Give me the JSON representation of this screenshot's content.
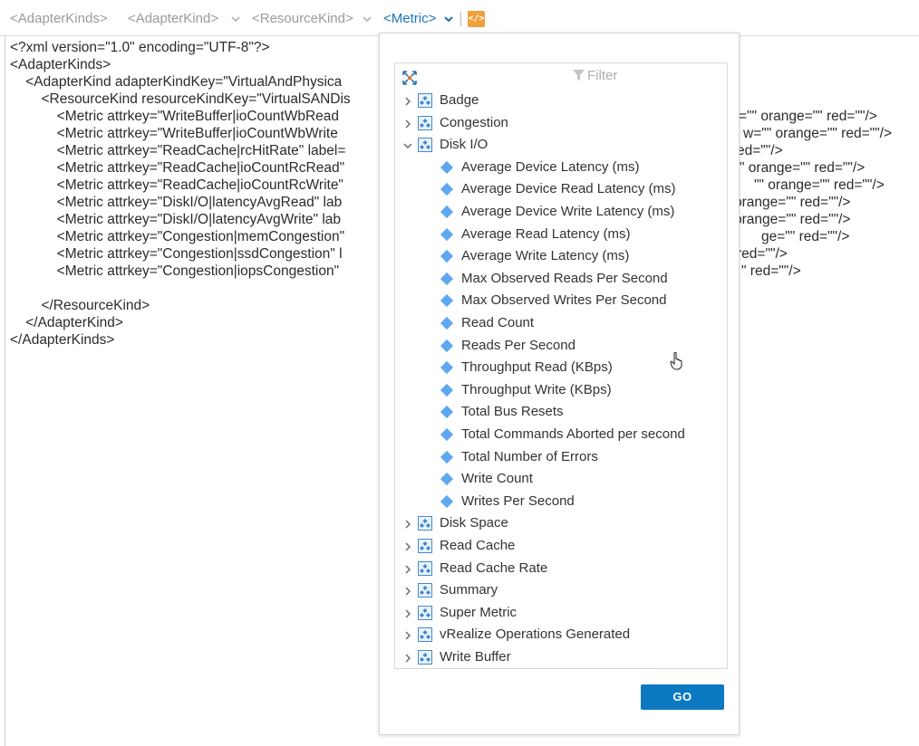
{
  "breadcrumbs": [
    {
      "label": "<AdapterKinds>"
    },
    {
      "label": "<AdapterKind>"
    },
    {
      "label": "<ResourceKind>"
    },
    {
      "label": "<Metric>"
    }
  ],
  "xml_toggle_label": "</>",
  "xml_lines": [
    "<?xml version=\"1.0\" encoding=\"UTF-8\"?>",
    "<AdapterKinds>",
    "    <AdapterKind adapterKindKey=\"VirtualAndPhysica",
    "        <ResourceKind resourceKindKey=\"VirtualSANDis",
    "            <Metric attrkey=\"WriteBuffer|ioCountWbRead",
    "            <Metric attrkey=\"WriteBuffer|ioCountWbWrite",
    "            <Metric attrkey=\"ReadCache|rcHitRate\" label=",
    "            <Metric attrkey=\"ReadCache|ioCountRcRead\"",
    "            <Metric attrkey=\"ReadCache|ioCountRcWrite\"",
    "            <Metric attrkey=\"DiskI/O|latencyAvgRead\" lab",
    "            <Metric attrkey=\"DiskI/O|latencyAvgWrite\" lab",
    "            <Metric attrkey=\"Congestion|memCongestion\"",
    "            <Metric attrkey=\"Congestion|ssdCongestion\" l",
    "            <Metric attrkey=\"Congestion|iopsCongestion\"",
    "",
    "        </ResourceKind>",
    "    </AdapterKind>",
    "</AdapterKinds>"
  ],
  "xml_tails": [
    "=\"\" orange=\"\" red=\"\"/>",
    "w=\"\" orange=\"\" red=\"\"/>",
    "ed=\"\"/>",
    "\" orange=\"\" red=\"\"/>",
    "\"\" orange=\"\" red=\"\"/>",
    "orange=\"\" red=\"\"/>",
    "orange=\"\" red=\"\"/>",
    "ge=\"\" red=\"\"/>",
    "red=\"\"/>",
    "\" red=\"\"/>"
  ],
  "filter_placeholder": "Filter",
  "tree": {
    "groups_before": [
      "Badge",
      "Congestion"
    ],
    "expanded_group": "Disk I/O",
    "expanded_children": [
      "Average Device Latency (ms)",
      "Average Device Read Latency (ms)",
      "Average Device Write Latency (ms)",
      "Average Read Latency (ms)",
      "Average Write Latency (ms)",
      "Max Observed Reads Per Second",
      "Max Observed Writes Per Second",
      "Read Count",
      "Reads Per Second",
      "Throughput Read (KBps)",
      "Throughput Write (KBps)",
      "Total Bus Resets",
      "Total Commands Aborted per second",
      "Total Number of Errors",
      "Write Count",
      "Writes Per Second"
    ],
    "groups_after": [
      "Disk Space",
      "Read Cache",
      "Read Cache Rate",
      "Summary",
      "Super Metric",
      "vRealize Operations Generated",
      "Write Buffer"
    ]
  },
  "go_label": "GO",
  "colors": {
    "accent": "#0c79c0",
    "leaf_icon": "#5fa8ef",
    "xml_toggle": "#f0a03c"
  }
}
